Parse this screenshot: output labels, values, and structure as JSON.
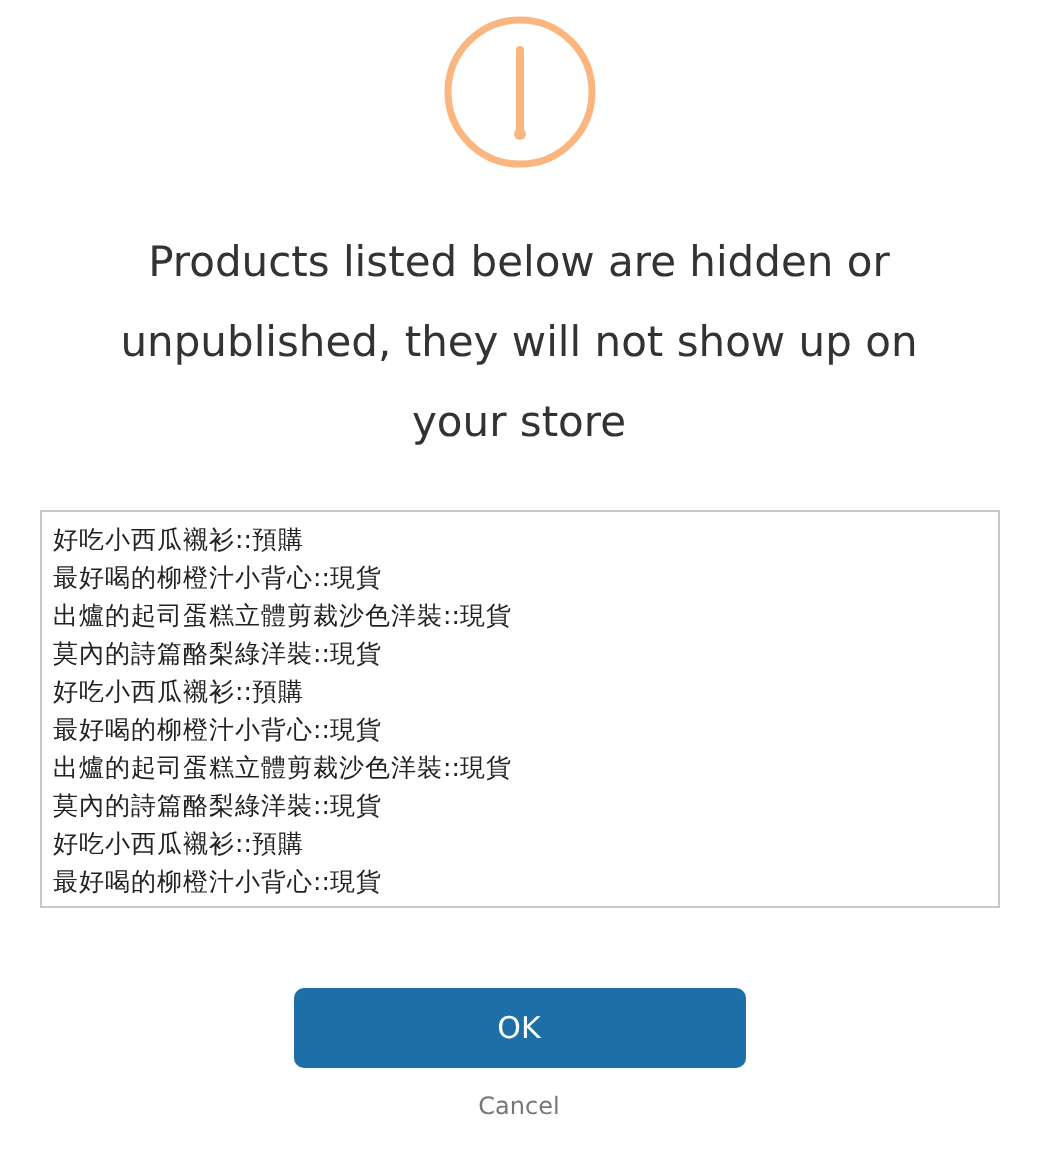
{
  "dialog": {
    "message": "Products listed below are hidden or unpublished, they will not show up on your store",
    "products": [
      "好吃小西瓜襯衫::預購",
      "最好喝的柳橙汁小背心::現貨",
      "出爐的起司蛋糕立體剪裁沙色洋裝::現貨",
      "莫內的詩篇酪梨綠洋裝::現貨",
      "好吃小西瓜襯衫::預購",
      "最好喝的柳橙汁小背心::現貨",
      "出爐的起司蛋糕立體剪裁沙色洋裝::現貨",
      "莫內的詩篇酪梨綠洋裝::現貨",
      "好吃小西瓜襯衫::預購",
      "最好喝的柳橙汁小背心::現貨"
    ],
    "ok_button": "OK",
    "cancel_link": "Cancel"
  }
}
